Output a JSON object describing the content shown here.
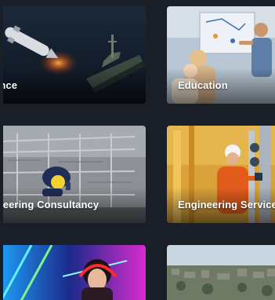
{
  "cards": [
    {
      "label": "ence"
    },
    {
      "label": "Education"
    },
    {
      "label": "ineering Consultancy"
    },
    {
      "label": "Engineering Service"
    },
    {
      "label": ""
    },
    {
      "label": ""
    }
  ]
}
